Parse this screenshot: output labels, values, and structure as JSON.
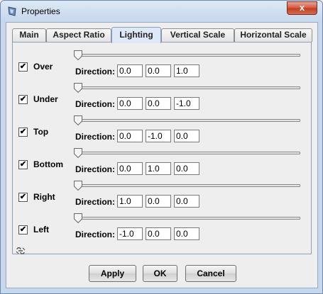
{
  "window": {
    "title": "Properties",
    "close_label": "x"
  },
  "tabs": [
    {
      "label": "Main"
    },
    {
      "label": "Aspect Ratio"
    },
    {
      "label": "Lighting",
      "active": true
    },
    {
      "label": "Vertical Scale"
    },
    {
      "label": "Horizontal Scale"
    }
  ],
  "direction_label": "Direction:",
  "lights": [
    {
      "label": "Over",
      "checked": true,
      "slider_fraction": 0.0,
      "direction": [
        "0.0",
        "0.0",
        "1.0"
      ]
    },
    {
      "label": "Under",
      "checked": true,
      "slider_fraction": 0.0,
      "direction": [
        "0.0",
        "0.0",
        "-1.0"
      ]
    },
    {
      "label": "Top",
      "checked": true,
      "slider_fraction": 0.0,
      "direction": [
        "0.0",
        "-1.0",
        "0.0"
      ]
    },
    {
      "label": "Bottom",
      "checked": true,
      "slider_fraction": 0.0,
      "direction": [
        "0.0",
        "1.0",
        "0.0"
      ]
    },
    {
      "label": "Right",
      "checked": true,
      "slider_fraction": 0.0,
      "direction": [
        "1.0",
        "0.0",
        "0.0"
      ]
    },
    {
      "label": "Left",
      "checked": true,
      "slider_fraction": 0.0,
      "direction": [
        "-1.0",
        "0.0",
        "0.0"
      ]
    }
  ],
  "buttons": {
    "apply": "Apply",
    "ok": "OK",
    "cancel": "Cancel"
  },
  "check_glyph": "✔"
}
